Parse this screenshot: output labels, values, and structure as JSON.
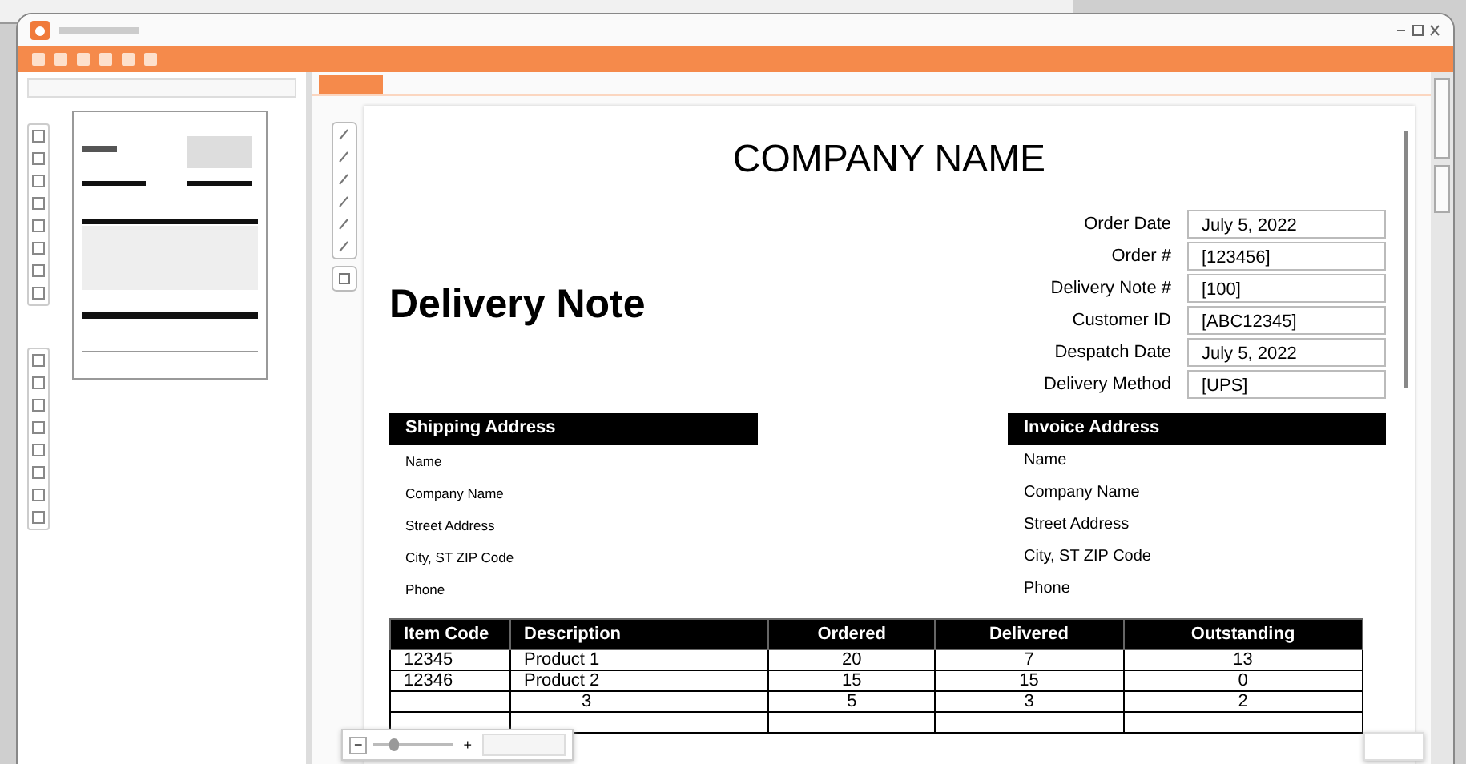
{
  "document": {
    "company": "COMPANY NAME",
    "title": "Delivery Note",
    "fields": [
      {
        "label": "Order Date",
        "value": "July 5, 2022"
      },
      {
        "label": "Order #",
        "value": "[123456]"
      },
      {
        "label": "Delivery Note #",
        "value": "[100]"
      },
      {
        "label": "Customer ID",
        "value": "[ABC12345]"
      },
      {
        "label": "Despatch Date",
        "value": "July 5, 2022"
      },
      {
        "label": "Delivery Method",
        "value": "[UPS]"
      }
    ],
    "addresses": [
      {
        "heading": "Shipping Address",
        "lines": [
          "Name",
          "Company Name",
          "Street Address",
          "City, ST  ZIP Code",
          "Phone"
        ]
      },
      {
        "heading": "Invoice Address",
        "lines": [
          "Name",
          "Company Name",
          "Street Address",
          "City, ST  ZIP Code",
          "Phone"
        ]
      }
    ],
    "items": {
      "columns": [
        "Item Code",
        "Description",
        "Ordered",
        "Delivered",
        "Outstanding"
      ],
      "rows": [
        [
          "12345",
          "Product 1",
          "20",
          "7",
          "13"
        ],
        [
          "12346",
          "Product 2",
          "15",
          "15",
          "0"
        ],
        [
          "",
          "3",
          "5",
          "3",
          "2"
        ],
        [
          "",
          "",
          "",
          "",
          ""
        ]
      ]
    }
  },
  "zoom_bar": {
    "minus": "−",
    "plus": "+",
    "level": 0.25
  }
}
